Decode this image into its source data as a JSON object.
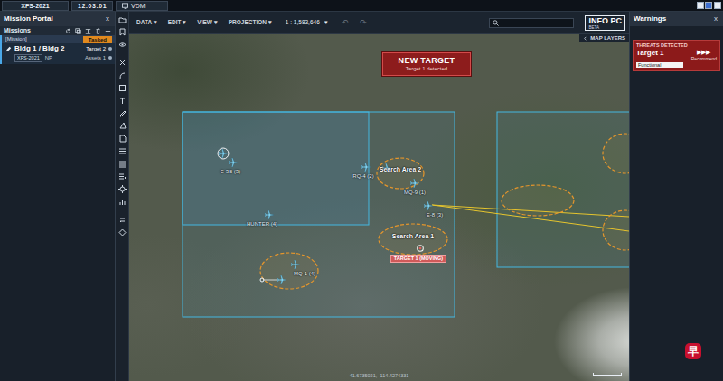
{
  "topbar": {
    "app": "XFS-2021",
    "clock": "12:03:01",
    "tab": "VDM"
  },
  "portal": {
    "title": "Mission Portal",
    "close": "x",
    "section": "Missions",
    "missions": [
      {
        "tag": "[Mission]",
        "status": "Tasked",
        "name": "Bldg 1 / Bldg 2",
        "targets": "Target 2",
        "code": "XFS-2021",
        "role": "NP",
        "assets": "Assets 1",
        "selected": true
      }
    ]
  },
  "toolbar": {
    "menus": [
      "DATA",
      "EDIT",
      "VIEW",
      "PROJECTION"
    ],
    "caret": "▾",
    "scale": "1 : 1,583,646",
    "undo": "↶",
    "redo": "↷",
    "logo": "INFO PC",
    "logo_sub": "BETA"
  },
  "map": {
    "layers": "MAP LAYERS",
    "alert": {
      "title": "NEW TARGET",
      "text": "Target 1 detected"
    },
    "areas": [
      "Search Area 2",
      "Search Area 1"
    ],
    "assets": [
      "E-3B (3)",
      "HUNTER (4)",
      "RQ-4 (2)",
      "MQ-9 (1)",
      "E-8 (3)",
      "MQ-1 (4)"
    ],
    "target_tag": "TARGET 1 (MOVING)",
    "coords": "41.6735021, -114.4274331"
  },
  "warnings": {
    "title": "Warnings",
    "close": "x",
    "threats": [
      {
        "header": "THREATS DETECTED",
        "name": "Target 1",
        "action": "▶▶▶",
        "action_label": "Recommend",
        "status": "Functional"
      }
    ]
  },
  "watermark": "早"
}
